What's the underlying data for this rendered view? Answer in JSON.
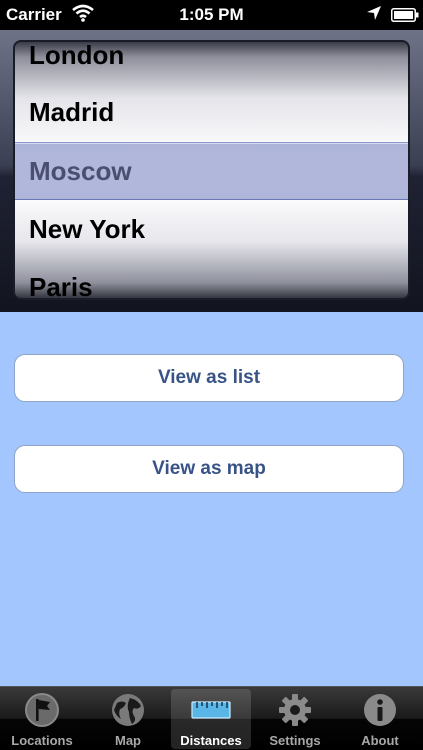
{
  "status_bar": {
    "carrier": "Carrier",
    "time": "1:05 PM"
  },
  "picker": {
    "items": [
      "London",
      "Madrid",
      "Moscow",
      "New York",
      "Paris"
    ],
    "selected": "Moscow"
  },
  "buttons": {
    "view_list": "View as list",
    "view_map": "View as map"
  },
  "tab_bar": {
    "active": "Distances",
    "tabs": [
      {
        "label": "Locations",
        "icon": "flag-icon"
      },
      {
        "label": "Map",
        "icon": "globe-icon"
      },
      {
        "label": "Distances",
        "icon": "ruler-icon"
      },
      {
        "label": "Settings",
        "icon": "gear-icon"
      },
      {
        "label": "About",
        "icon": "info-icon"
      }
    ]
  },
  "colors": {
    "background": "#a3c6fe",
    "button_text": "#385487",
    "selection": "#707cbe"
  }
}
